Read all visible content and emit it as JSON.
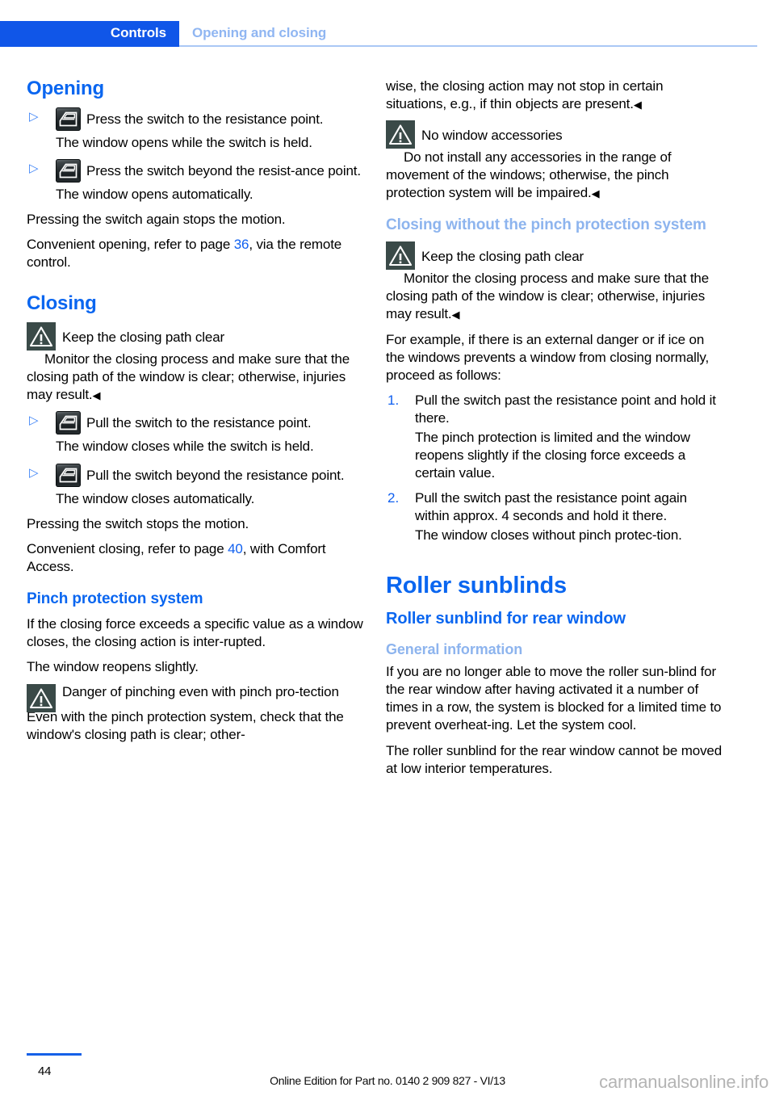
{
  "header": {
    "chapter": "Controls",
    "section": "Opening and closing"
  },
  "left_column": {
    "opening_heading": "Opening",
    "step_open_1_text": "Press the switch to the resistance point.",
    "step_open_1_result": "The window opens while the switch is held.",
    "step_open_2_text": "Press the switch beyond the resist-ance point.",
    "step_open_2_result": "The window opens automatically.",
    "para_stops_motion": "Pressing the switch again stops the motion.",
    "para_convenient_opening_pre": "Convenient opening, refer to page ",
    "para_convenient_opening_ref": "36",
    "para_convenient_opening_post": ", via the remote control.",
    "closing_heading": "Closing",
    "warn_closing_title": "Keep the closing path clear",
    "warn_closing_body": "Monitor the closing process and make sure that the closing path of the window is clear; otherwise, injuries may result.",
    "step_close_1_text": "Pull the switch to the resistance point.",
    "step_close_1_result": "The window closes while the switch is held.",
    "step_close_2_text": "Pull the switch beyond the resistance point.",
    "step_close_2_result": "The window closes automatically.",
    "para_switch_stops": "Pressing the switch stops the motion.",
    "para_convenient_closing_pre": "Convenient closing, refer to page ",
    "para_convenient_closing_ref": "40",
    "para_convenient_closing_post": ", with Comfort Access.",
    "pinch_heading": "Pinch protection system",
    "para_pinch_1": "If the closing force exceeds a specific value as a window closes, the closing action is inter-rupted.",
    "para_pinch_2": "The window reopens slightly.",
    "warn_pinch_title": "Danger of pinching even with pinch pro-tection",
    "para_pinch_3": "Even with the pinch protection system, check that the window's closing path is clear; other-"
  },
  "right_column": {
    "para_continued": "wise, the closing action may not stop in certain situations, e.g., if thin objects are present.",
    "warn_accessories_title": "No window accessories",
    "warn_accessories_body": "Do not install any accessories in the range of movement of the windows; otherwise, the pinch protection system will be impaired.",
    "closing_without_heading": "Closing without the pinch protection system",
    "warn_keep_clear_title": "Keep the closing path clear",
    "warn_keep_clear_body": "Monitor the closing process and make sure that the closing path of the window is clear; otherwise, injuries may result.",
    "para_example": "For example, if there is an external danger or if ice on the windows prevents a window from closing normally, proceed as follows:",
    "numbered_steps": [
      {
        "marker": "1.",
        "text": "Pull the switch past the resistance point and hold it there.",
        "result": "The pinch protection is limited and the window reopens slightly if the closing force exceeds a certain value."
      },
      {
        "marker": "2.",
        "text": "Pull the switch past the resistance point again within approx. 4 seconds and hold it there.",
        "result": "The window closes without pinch protec-tion."
      }
    ],
    "roller_sunblinds_heading": "Roller sunblinds",
    "roller_rear_heading": "Roller sunblind for rear window",
    "general_info_heading": "General information",
    "para_general_1": "If you are no longer able to move the roller sun-blind for the rear window after having activated it a number of times in a row, the system is blocked for a limited time to prevent overheat-ing. Let the system cool.",
    "para_general_2": "The roller sunblind for the rear window cannot be moved at low interior temperatures."
  },
  "footer": {
    "page_number": "44",
    "edition": "Online Edition for Part no. 0140 2 909 827 - VI/13",
    "watermark": "carmanualsonline.info"
  },
  "symbols": {
    "bullet_marker": "▷",
    "end_marker": "◀"
  },
  "colors": {
    "brand_blue": "#0a66f0",
    "header_blue": "#1056e8",
    "light_blue": "#8db4ee",
    "warn_bg": "#3a4a48"
  }
}
